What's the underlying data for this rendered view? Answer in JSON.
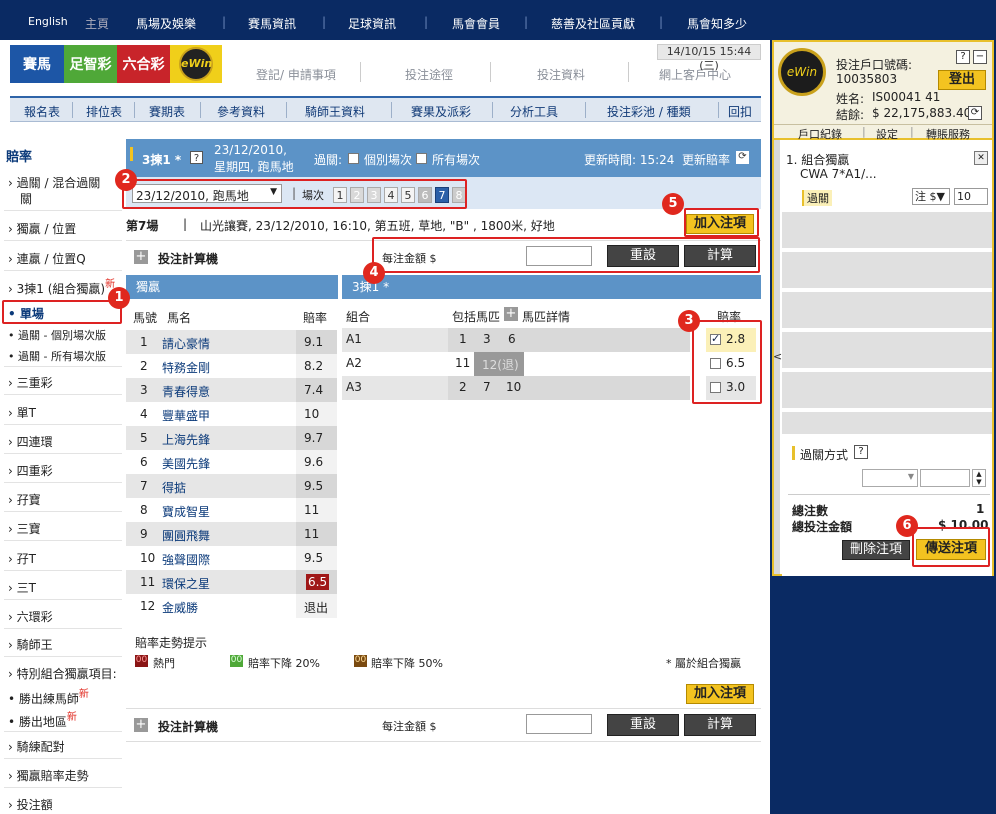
{
  "top_nav": {
    "english": "English",
    "items": [
      "主頁",
      "馬場及娛樂",
      "賽馬資訊",
      "足球資訊",
      "馬會會員",
      "慈善及社區貢獻",
      "馬會知多少"
    ]
  },
  "brand": {
    "horse": "賽馬",
    "football": "足智彩",
    "marksix": "六合彩",
    "ewin": "eWin 投注區"
  },
  "sub_nav": [
    "登記/ 申請事項",
    "投注途徑",
    "投注資料",
    "網上客戶中心"
  ],
  "datetime": "14/10/15 15:44 (三)",
  "menu": [
    "報名表",
    "排位表",
    "賽期表",
    "參考資料",
    "騎師王資料",
    "賽果及派彩",
    "分析工具",
    "投注彩池 / 種類",
    "回扣"
  ],
  "sidebar": {
    "title": "賠率",
    "items": [
      "過關 / 混合過關",
      "獨贏 / 位置",
      "連贏 / 位置Q",
      "3揀1 (組合獨贏)",
      "單場",
      "過關 - 個別場次版",
      "過關 - 所有場次版",
      "三重彩",
      "單T",
      "四連環",
      "四重彩",
      "孖寶",
      "三寶",
      "孖T",
      "三T",
      "六環彩",
      "騎師王",
      "特別組合獨贏項目:",
      "勝出練馬師",
      "勝出地區",
      "騎練配對",
      "獨贏賠率走勢",
      "投注額"
    ],
    "new_badge": "新"
  },
  "race_header": {
    "title": "3揀1 *",
    "help": "?",
    "date_line1": "23/12/2010,",
    "date_line2": "星期四, 跑馬地",
    "pass_label": "過關:",
    "opt_single": "個別場次",
    "opt_all": "所有場次",
    "update_label": "更新時間: 15:24",
    "refresh_label": "更新賠率"
  },
  "selector": {
    "date_value": "23/12/2010, 跑馬地",
    "race_label": "場次",
    "races": [
      "1",
      "2",
      "3",
      "4",
      "5",
      "6",
      "7",
      "8"
    ],
    "selected_race": "7"
  },
  "race_info": {
    "number": "第7場",
    "sep": "|",
    "desc": "山光讓賽, 23/12/2010, 16:10, 第五班, 草地, \"B\" , 1800米, 好地"
  },
  "add_bet": "加入注項",
  "calculator": {
    "title": "投注計算機",
    "unit_label": "每注金額 $",
    "reset": "重設",
    "calc": "計算"
  },
  "win_table": {
    "title": "獨贏",
    "col_no": "馬號",
    "col_name": "馬名",
    "col_odds": "賠率",
    "rows": [
      [
        "1",
        "請心豪情",
        "9.1"
      ],
      [
        "2",
        "特務金剛",
        "8.2"
      ],
      [
        "3",
        "青春得意",
        "7.4"
      ],
      [
        "4",
        "豐華盛甲",
        "10"
      ],
      [
        "5",
        "上海先鋒",
        "9.7"
      ],
      [
        "6",
        "美國先鋒",
        "9.6"
      ],
      [
        "7",
        "得掂",
        "9.5"
      ],
      [
        "8",
        "寶成智星",
        "11"
      ],
      [
        "9",
        "團圓飛舞",
        "11"
      ],
      [
        "10",
        "強聲國際",
        "9.5"
      ],
      [
        "11",
        "環保之星",
        "6.5"
      ],
      [
        "12",
        "金威勝",
        "退出"
      ]
    ]
  },
  "comb_table": {
    "title": "3揀1 *",
    "col_comb": "組合",
    "col_horses": "包括馬匹",
    "col_detail": "馬匹詳情",
    "col_odds": "賠率",
    "rows": [
      {
        "id": "A1",
        "h": [
          "1",
          "3",
          "6"
        ],
        "odds": "2.8"
      },
      {
        "id": "A2",
        "h": [
          "11",
          "12(退)"
        ],
        "odds": "6.5"
      },
      {
        "id": "A3",
        "h": [
          "2",
          "7",
          "10"
        ],
        "odds": "3.0"
      }
    ]
  },
  "trend": {
    "title": "賠率走勢提示",
    "hot_code": "00",
    "hot": "熱門",
    "drop20_code": "00",
    "drop20": "賠率下降 20%",
    "drop50_code": "00",
    "drop50": "賠率下降 50%",
    "note": "* 屬於組合獨贏"
  },
  "annotations": [
    "1",
    "2",
    "3",
    "4",
    "5",
    "6"
  ],
  "account": {
    "acct_label": "投注戶口號碼:",
    "acct_no": "10035803",
    "name_label": "姓名:",
    "name": "IS00041 41",
    "bal_label": "結餘:",
    "balance": "$ 22,175,883.40",
    "logout": "登出",
    "links": [
      "戶口紀錄",
      "設定",
      "轉賬服務"
    ],
    "help": "?",
    "minus": "−"
  },
  "slip": {
    "item_title": "1. 組合獨贏",
    "item_detail": "CWA 7*A1/...",
    "pass_tag": "過關",
    "unit_sel": "注 $▼",
    "amount": "10",
    "close": "✕",
    "mode_label": "過關方式",
    "mode_help": "?",
    "total_bets_label": "總注數",
    "total_bets": "1",
    "total_amt_label": "總投注金額",
    "total_amt": "$ 10.00",
    "delete": "刪除注項",
    "send": "傳送注項",
    "collapse": "<"
  },
  "colors": {
    "navy": "#0a2a63",
    "blue": "#5c93c7",
    "gold": "#f3c320",
    "red": "#e0281e"
  }
}
